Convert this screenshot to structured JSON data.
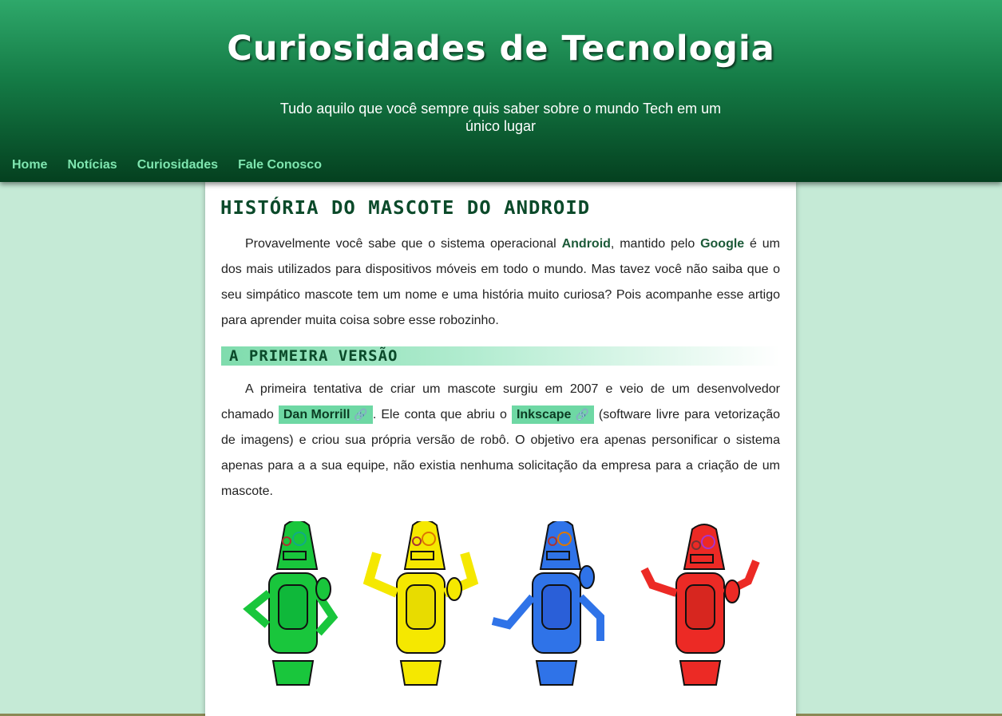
{
  "header": {
    "title": "Curiosidades de Tecnologia",
    "subtitle": "Tudo aquilo que você sempre quis saber sobre o mundo Tech em um único lugar"
  },
  "nav": {
    "items": [
      {
        "label": "Home"
      },
      {
        "label": "Notícias"
      },
      {
        "label": "Curiosidades"
      },
      {
        "label": "Fale Conosco"
      }
    ]
  },
  "article": {
    "title": "História do Mascote do Android",
    "intro": {
      "t1": "Provavelmente você sabe que o sistema operacional ",
      "android": "Android",
      "t2": ", mantido pelo ",
      "google": "Google",
      "t3": " é um dos mais utilizados para dispositivos móveis em todo o mundo. Mas tavez você não saiba que o seu simpático mascote tem um nome e uma história muito curiosa? Pois acompanhe esse artigo para aprender muita coisa sobre esse robozinho."
    },
    "section1": {
      "heading": "A Primeira Versão",
      "t1": "A primeira tentativa de criar um mascote surgiu em 2007 e veio de um desenvolvedor chamado ",
      "link1": "Dan Morrill",
      "t2": ". Ele conta que abriu o ",
      "link2": "Inkscape",
      "t3": " (software livre para vetorização de imagens) e criou sua própria versão de robô. O objetivo era apenas personificar o sistema apenas para a a sua equipe, não existia nenhuma solicitação da empresa para a criação de um mascote."
    },
    "mascots": [
      {
        "name": "green-robot",
        "body": "#19c63c",
        "light": "#0fb83a",
        "pose": "hands-on-hips"
      },
      {
        "name": "yellow-robot",
        "body": "#f5e800",
        "light": "#e8dc00",
        "pose": "arms-up"
      },
      {
        "name": "blue-robot",
        "body": "#2f73e8",
        "light": "#2a5fd8",
        "pose": "arms-down"
      },
      {
        "name": "red-robot",
        "body": "#ec2a25",
        "light": "#d7261f",
        "pose": "arms-out"
      }
    ]
  },
  "icons": {
    "link": "link-icon"
  },
  "colors": {
    "header_top": "#2ea86a",
    "header_bottom": "#04401f",
    "nav_link": "#7fe6b0",
    "page_bg": "#c5ead6",
    "chip_bg": "#6ed8a4"
  }
}
